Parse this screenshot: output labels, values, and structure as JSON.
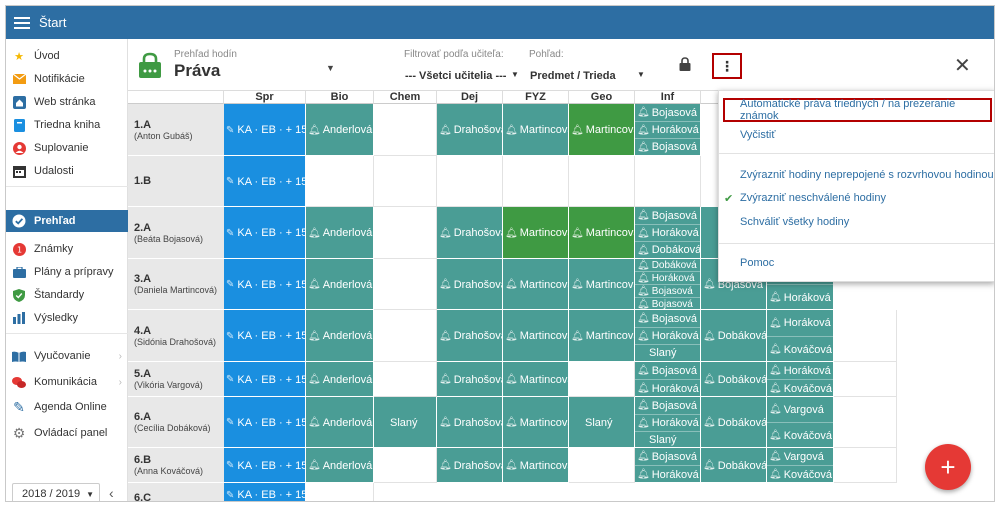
{
  "app": {
    "title": "Štart"
  },
  "sidebar": {
    "items": [
      {
        "label": "Úvod",
        "icon": "star-icon"
      },
      {
        "label": "Notifikácie",
        "icon": "envelope-icon"
      },
      {
        "label": "Web stránka",
        "icon": "home-icon"
      },
      {
        "label": "Triedna kniha",
        "icon": "book-icon"
      },
      {
        "label": "Suplovanie",
        "icon": "person-icon"
      },
      {
        "label": "Udalosti",
        "icon": "calendar-icon"
      },
      {
        "label": "Prehľad",
        "icon": "check-circle-icon"
      },
      {
        "label": "Známky",
        "icon": "grades-icon"
      },
      {
        "label": "Plány a prípravy",
        "icon": "briefcase-icon"
      },
      {
        "label": "Štandardy",
        "icon": "shield-icon"
      },
      {
        "label": "Výsledky",
        "icon": "bar-chart-icon"
      },
      {
        "label": "Vyučovanie",
        "icon": "open-book-icon"
      },
      {
        "label": "Komunikácia",
        "icon": "chat-icon"
      },
      {
        "label": "Agenda Online",
        "icon": "pen-icon"
      },
      {
        "label": "Ovládací panel",
        "icon": "gear-icon"
      }
    ],
    "year": "2018 / 2019"
  },
  "header": {
    "subtitle": "Prehľad hodín",
    "title": "Práva",
    "filter_teacher_label": "Filtrovať podľa učiteľa:",
    "filter_teacher_value": "--- Všetci učitelia ---",
    "view_label": "Pohľad:",
    "view_value": "Predmet / Trieda"
  },
  "columns": [
    "Spr",
    "Bio",
    "Chem",
    "Dej",
    "FYZ",
    "Geo",
    "Inf"
  ],
  "rows": [
    {
      "cls": "1.A",
      "teacher": "(Anton Gubáš)"
    },
    {
      "cls": "1.B",
      "teacher": ""
    },
    {
      "cls": "2.A",
      "teacher": "(Beáta Bojasová)"
    },
    {
      "cls": "3.A",
      "teacher": "(Daniela Martincová)"
    },
    {
      "cls": "4.A",
      "teacher": "(Sidónia Drahošová)"
    },
    {
      "cls": "5.A",
      "teacher": "(Vikória Vargová)"
    },
    {
      "cls": "6.A",
      "teacher": "(Cecília Dobáková)"
    },
    {
      "cls": "6.B",
      "teacher": "(Anna Kováčová)"
    },
    {
      "cls": "6.C",
      "teacher": ""
    }
  ],
  "cells": {
    "spr": "KA · EB · + 15",
    "bio": "Anderlová",
    "chem": "Slaný",
    "dej": "Drahošová",
    "fyz": "Martincová",
    "geo_a": "Martincová",
    "geo_b": "Slaný",
    "n_bojasova": "Bojasová",
    "n_horakova": "Horáková",
    "n_dobakova": "Dobáková",
    "n_slany": "Slaný",
    "n_kovacova": "Kováčová",
    "n_vargova": "Vargová"
  },
  "menu": {
    "items": [
      "Automatické práva triednych / na prezeranie známok",
      "Vyčistiť",
      "Zvýrazniť hodiny neprepojené s rozvrhovou hodinou",
      "Zvýrazniť neschválené hodiny",
      "Schváliť všetky hodiny",
      "Pomoc"
    ]
  },
  "fab": {
    "label": "+"
  }
}
